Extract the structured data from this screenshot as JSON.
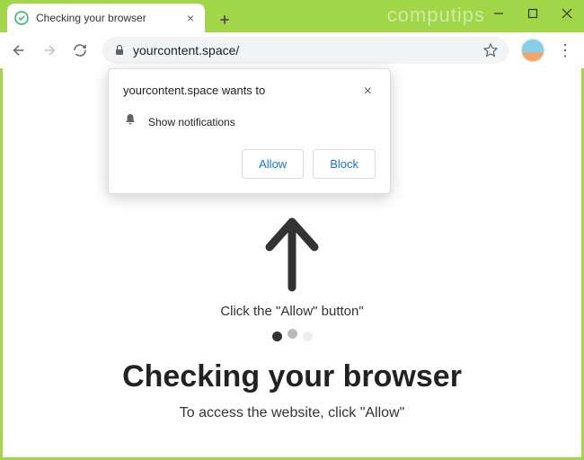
{
  "watermark": "computips",
  "tab": {
    "title": "Checking your browser"
  },
  "address_bar": {
    "url": "yourcontent.space/"
  },
  "permission_popup": {
    "title": "yourcontent.space wants to",
    "request_text": "Show notifications",
    "allow_label": "Allow",
    "block_label": "Block"
  },
  "page": {
    "hint": "Click the \"Allow\" button\"",
    "heading": "Checking your browser",
    "subtitle": "To access the website, click \"Allow\""
  }
}
